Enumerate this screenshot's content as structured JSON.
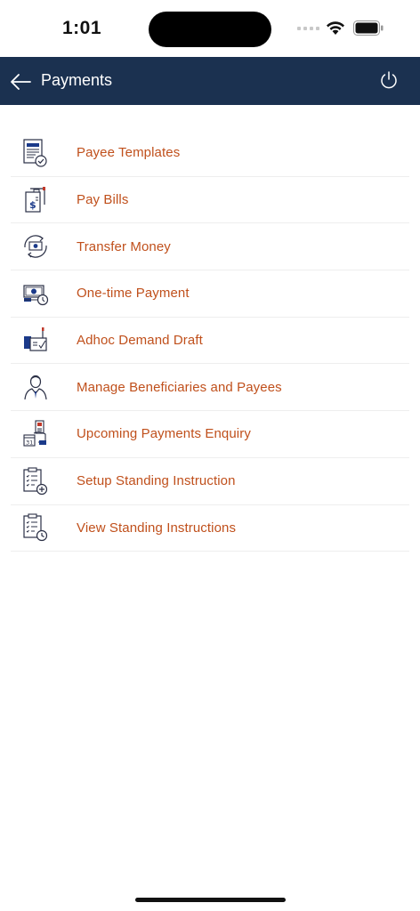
{
  "status_bar": {
    "time": "1:01"
  },
  "header": {
    "title": "Payments",
    "back_icon": "arrow-left-icon",
    "power_icon": "power-icon"
  },
  "menu": {
    "items": [
      {
        "label": "Payee Templates",
        "icon": "document-check-icon"
      },
      {
        "label": "Pay Bills",
        "icon": "bill-dollar-icon"
      },
      {
        "label": "Transfer Money",
        "icon": "money-transfer-icon"
      },
      {
        "label": "One-time Payment",
        "icon": "cash-clock-icon"
      },
      {
        "label": "Adhoc Demand Draft",
        "icon": "demand-draft-icon"
      },
      {
        "label": "Manage Beneficiaries and Payees",
        "icon": "person-icon"
      },
      {
        "label": "Upcoming Payments Enquiry",
        "icon": "calendar-payment-icon"
      },
      {
        "label": "Setup Standing Instruction",
        "icon": "clipboard-add-icon"
      },
      {
        "label": "View Standing Instructions",
        "icon": "clipboard-clock-icon"
      }
    ]
  },
  "colors": {
    "header_bg": "#1b3150",
    "label": "#c0501c",
    "icon_stroke": "#2a2f45",
    "icon_accent": "#1b3a8a",
    "icon_red": "#c0392b"
  }
}
